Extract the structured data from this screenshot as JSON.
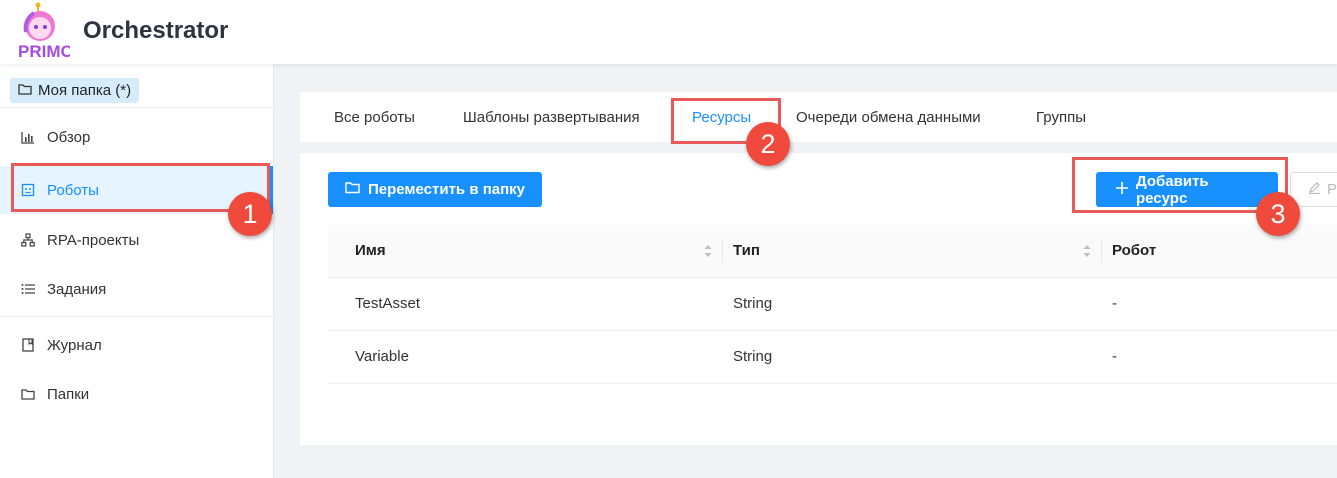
{
  "header": {
    "logo_text": "PRIMO",
    "title": "Orchestrator"
  },
  "sidebar": {
    "folder_chip": "Моя папка (*)",
    "items": [
      {
        "label": "Обзор",
        "icon": "chart-bar-icon"
      },
      {
        "label": "Роботы",
        "icon": "robot-icon",
        "active": true
      },
      {
        "label": "RPA-проекты",
        "icon": "hierarchy-icon"
      },
      {
        "label": "Задания",
        "icon": "list-icon"
      },
      {
        "label": "Журнал",
        "icon": "book-icon"
      },
      {
        "label": "Папки",
        "icon": "folder-icon"
      }
    ]
  },
  "tabs": [
    {
      "label": "Все роботы"
    },
    {
      "label": "Шаблоны развертывания"
    },
    {
      "label": "Ресурсы",
      "active": true
    },
    {
      "label": "Очереди обмена данными"
    },
    {
      "label": "Группы"
    }
  ],
  "toolbar": {
    "move_label": "Переместить в папку",
    "add_label": "Добавить ресурс",
    "edit_label": "Р"
  },
  "table": {
    "headers": [
      "Имя",
      "Тип",
      "Робот"
    ],
    "rows": [
      [
        "TestAsset",
        "String",
        "-"
      ],
      [
        "Variable",
        "String",
        "-"
      ]
    ]
  },
  "annotations": [
    "1",
    "2",
    "3"
  ],
  "colors": {
    "accent": "#1890ff",
    "highlight": "#e85a5a",
    "badge": "#ef4a3c"
  }
}
